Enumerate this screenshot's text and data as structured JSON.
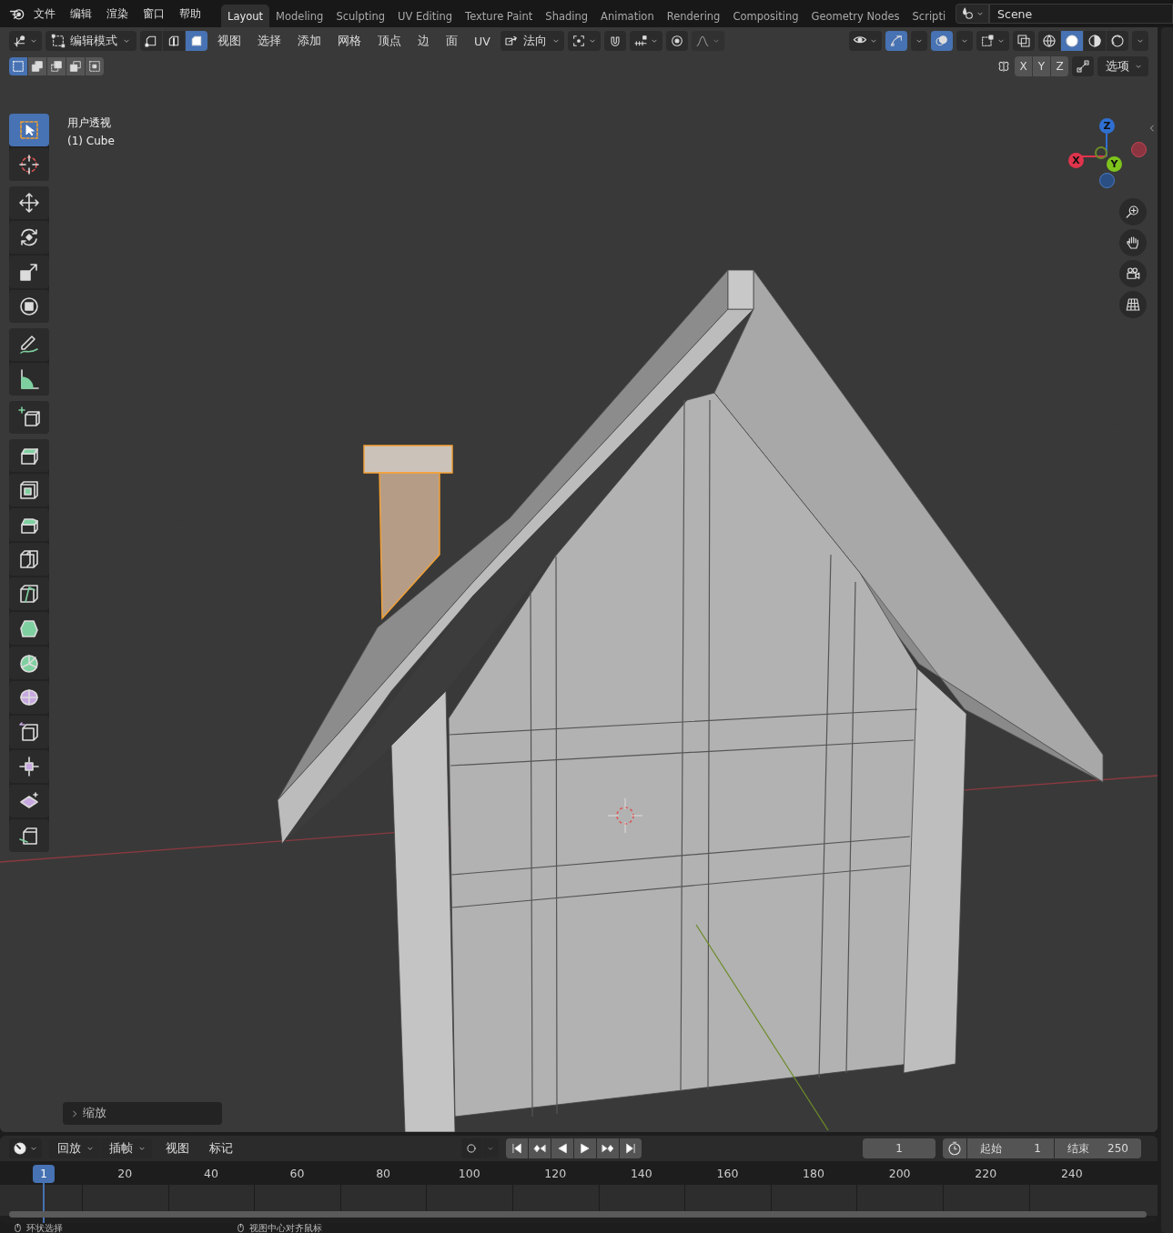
{
  "topbar": {
    "menus": [
      "文件",
      "编辑",
      "渲染",
      "窗口",
      "帮助"
    ],
    "workspaces": [
      {
        "label": "Layout",
        "selected": true
      },
      {
        "label": "Modeling",
        "selected": false
      },
      {
        "label": "Sculpting",
        "selected": false
      },
      {
        "label": "UV Editing",
        "selected": false
      },
      {
        "label": "Texture Paint",
        "selected": false
      },
      {
        "label": "Shading",
        "selected": false
      },
      {
        "label": "Animation",
        "selected": false
      },
      {
        "label": "Rendering",
        "selected": false
      },
      {
        "label": "Compositing",
        "selected": false
      },
      {
        "label": "Geometry Nodes",
        "selected": false
      },
      {
        "label": "Scripti",
        "selected": false
      }
    ],
    "scene": "Scene"
  },
  "header": {
    "mode": "编辑模式",
    "select_modes": [
      {
        "kind": "vertex",
        "selected": false
      },
      {
        "kind": "edge",
        "selected": false
      },
      {
        "kind": "face",
        "selected": true
      }
    ],
    "menus": [
      "视图",
      "选择",
      "添加",
      "网格",
      "顶点",
      "边",
      "面",
      "UV"
    ],
    "orientation": "法向",
    "snapping": {
      "on": false
    },
    "proportional": {
      "on": false
    },
    "gizmos": {
      "on": true
    },
    "overlays": {
      "on": true
    },
    "xray": {
      "on": false
    },
    "shading": [
      {
        "kind": "wireframe",
        "selected": false
      },
      {
        "kind": "solid",
        "selected": true
      },
      {
        "kind": "material",
        "selected": false
      },
      {
        "kind": "rendered",
        "selected": false
      }
    ]
  },
  "tool_settings": {
    "box_modes": [
      {
        "kind": "new",
        "selected": true
      },
      {
        "kind": "extend",
        "selected": false
      },
      {
        "kind": "subtract",
        "selected": false
      },
      {
        "kind": "invert",
        "selected": false
      },
      {
        "kind": "intersect",
        "selected": false
      }
    ],
    "mirror": [
      {
        "label": "X",
        "on": false
      },
      {
        "label": "Y",
        "on": false
      },
      {
        "label": "Z",
        "on": false
      }
    ],
    "options": "选项"
  },
  "viewport": {
    "view_name": "用户透视",
    "object_name": "(1) Cube",
    "axes": [
      {
        "label": "Z",
        "color": "#2f6fd1"
      },
      {
        "label": "X",
        "color": "#e0344c"
      },
      {
        "label": "Y",
        "color": "#7ec41c"
      }
    ],
    "last_operator": "缩放"
  },
  "toolbar": {
    "groups": [
      [
        {
          "kind": "select_box",
          "selected": true
        },
        {
          "kind": "cursor",
          "selected": false
        }
      ],
      [
        {
          "kind": "move",
          "selected": false
        },
        {
          "kind": "rotate",
          "selected": false
        },
        {
          "kind": "scale",
          "selected": false
        },
        {
          "kind": "transform",
          "selected": false
        }
      ],
      [
        {
          "kind": "annotate",
          "selected": false
        },
        {
          "kind": "measure",
          "selected": false
        }
      ],
      [
        {
          "kind": "add_cube",
          "selected": false
        }
      ],
      [
        {
          "kind": "extrude",
          "selected": false
        },
        {
          "kind": "inset",
          "selected": false
        },
        {
          "kind": "bevel",
          "selected": false
        },
        {
          "kind": "loop_cut",
          "selected": false
        },
        {
          "kind": "knife",
          "selected": false
        },
        {
          "kind": "poly_build",
          "selected": false
        },
        {
          "kind": "spin",
          "selected": false
        },
        {
          "kind": "smooth",
          "selected": false
        },
        {
          "kind": "edge_slide",
          "selected": false
        },
        {
          "kind": "shrink_fatten",
          "selected": false
        },
        {
          "kind": "shear",
          "selected": false
        },
        {
          "kind": "rip",
          "selected": false
        }
      ]
    ]
  },
  "timeline": {
    "menus": [
      {
        "label": "回放",
        "kind": "dropdown"
      },
      {
        "label": "插帧",
        "kind": "dropdown"
      },
      {
        "label": "视图",
        "kind": "menu"
      },
      {
        "label": "标记",
        "kind": "menu"
      }
    ],
    "current_frame": "1",
    "start_label": "起始",
    "start": "1",
    "end_label": "结束",
    "end": "250",
    "playhead": "1",
    "ruler": [
      "20",
      "40",
      "60",
      "80",
      "100",
      "120",
      "140",
      "160",
      "180",
      "200",
      "220",
      "240"
    ]
  },
  "status_bar": [
    "环状选择",
    "视图中心对齐鼠标"
  ]
}
